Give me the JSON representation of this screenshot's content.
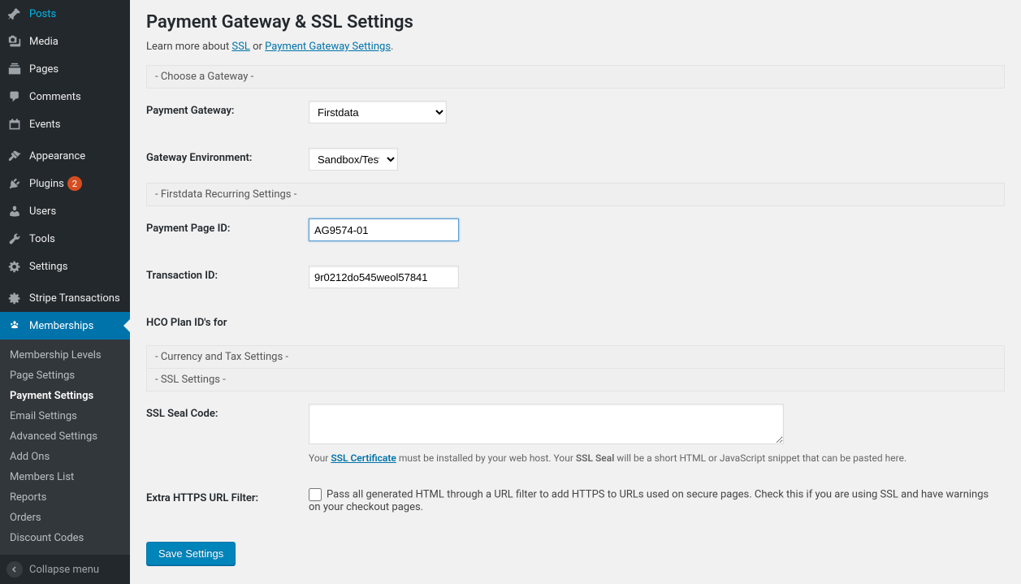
{
  "sidebar": {
    "items": [
      {
        "icon": "pin",
        "label": "Posts"
      },
      {
        "icon": "media",
        "label": "Media"
      },
      {
        "icon": "page",
        "label": "Pages"
      },
      {
        "icon": "comment",
        "label": "Comments"
      },
      {
        "icon": "calendar",
        "label": "Events"
      },
      null,
      {
        "icon": "appearance",
        "label": "Appearance"
      },
      {
        "icon": "plugin",
        "label": "Plugins",
        "badge": "2"
      },
      {
        "icon": "user",
        "label": "Users"
      },
      {
        "icon": "tool",
        "label": "Tools"
      },
      {
        "icon": "settings",
        "label": "Settings"
      },
      null,
      {
        "icon": "stripe",
        "label": "Stripe Transactions"
      },
      {
        "icon": "memberships",
        "label": "Memberships",
        "active": true
      }
    ],
    "submenu": [
      {
        "label": "Membership Levels"
      },
      {
        "label": "Page Settings"
      },
      {
        "label": "Payment Settings",
        "active": true
      },
      {
        "label": "Email Settings"
      },
      {
        "label": "Advanced Settings"
      },
      {
        "label": "Add Ons"
      },
      {
        "label": "Members List"
      },
      {
        "label": "Reports"
      },
      {
        "label": "Orders"
      },
      {
        "label": "Discount Codes"
      }
    ],
    "collapse": "Collapse menu"
  },
  "page": {
    "title": "Payment Gateway & SSL Settings",
    "intro_prefix": "Learn more about ",
    "intro_link1": "SSL",
    "intro_mid": " or ",
    "intro_link2": "Payment Gateway Settings",
    "intro_suffix": ".",
    "section_choose": "- Choose a Gateway -",
    "field_gateway": "Payment Gateway:",
    "gateway_value": "Firstdata",
    "field_env": "Gateway Environment:",
    "env_value": "Sandbox/Testing",
    "section_recurring": "- Firstdata Recurring Settings -",
    "field_page_id": "Payment Page ID:",
    "page_id_value": "AG9574-01",
    "field_txn_id": "Transaction ID:",
    "txn_id_value": "9r0212do545weol57841",
    "field_hco": "HCO Plan ID's for",
    "section_currency": "- Currency and Tax Settings -",
    "section_ssl": "- SSL Settings -",
    "field_seal": "SSL Seal Code:",
    "seal_hint_prefix": "Your ",
    "seal_hint_link": "SSL Certificate",
    "seal_hint_mid": " must be installed by your web host. Your ",
    "seal_hint_strong": "SSL Seal",
    "seal_hint_suffix": " will be a short HTML or JavaScript snippet that can be pasted here.",
    "field_filter": "Extra HTTPS URL Filter:",
    "filter_desc": "Pass all generated HTML through a URL filter to add HTTPS to URLs used on secure pages. Check this if you are using SSL and have warnings on your checkout pages.",
    "save": "Save Settings"
  }
}
